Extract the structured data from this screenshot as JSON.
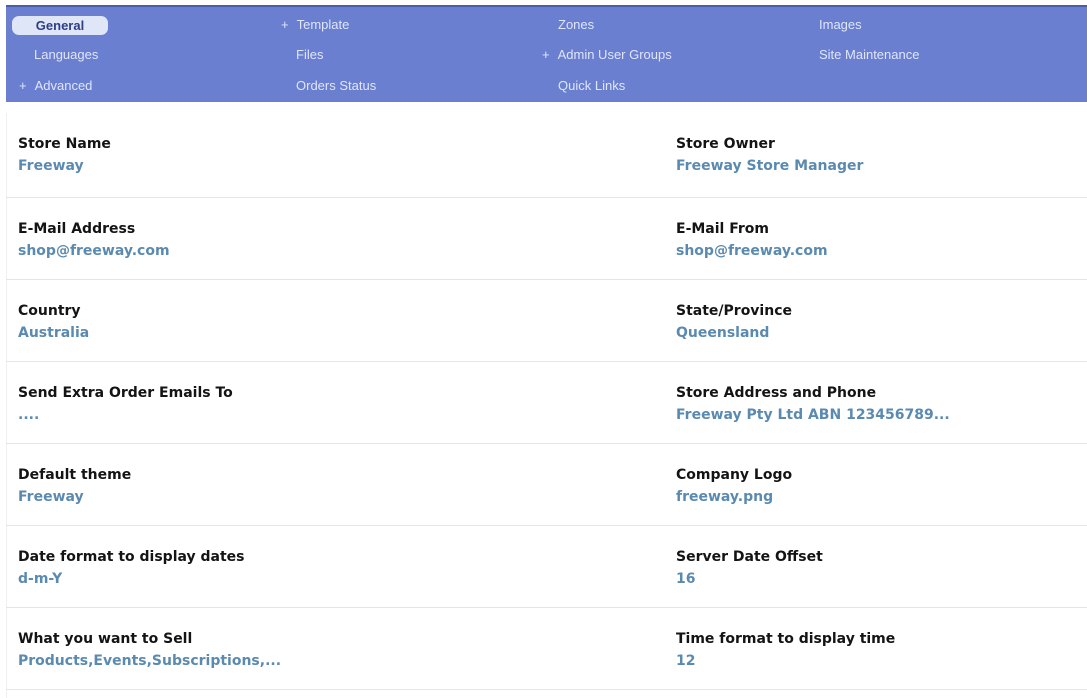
{
  "nav": {
    "col1": [
      {
        "label": "General",
        "plus": "",
        "active": true
      },
      {
        "label": "Languages",
        "plus": ""
      },
      {
        "label": "Advanced",
        "plus": "+"
      }
    ],
    "col2": [
      {
        "label": "Template",
        "plus": "+"
      },
      {
        "label": "Files",
        "plus": ""
      },
      {
        "label": "Orders Status",
        "plus": ""
      }
    ],
    "col3": [
      {
        "label": "Zones",
        "plus": ""
      },
      {
        "label": "Admin User Groups",
        "plus": "+"
      },
      {
        "label": "Quick Links",
        "plus": ""
      }
    ],
    "col4": [
      {
        "label": "Images",
        "plus": ""
      },
      {
        "label": "Site Maintenance",
        "plus": ""
      }
    ]
  },
  "settings": [
    {
      "left": {
        "label": "Store Name",
        "value": "Freeway"
      },
      "right": {
        "label": "Store Owner",
        "value": "Freeway Store Manager"
      }
    },
    {
      "left": {
        "label": "E-Mail Address",
        "value": "shop@freeway.com"
      },
      "right": {
        "label": "E-Mail From",
        "value": "shop@freeway.com"
      }
    },
    {
      "left": {
        "label": "Country",
        "value": "Australia"
      },
      "right": {
        "label": "State/Province",
        "value": "Queensland"
      }
    },
    {
      "left": {
        "label": "Send Extra Order Emails To",
        "value": "...."
      },
      "right": {
        "label": "Store Address and Phone",
        "value": "Freeway Pty Ltd ABN 123456789..."
      }
    },
    {
      "left": {
        "label": "Default theme",
        "value": "Freeway"
      },
      "right": {
        "label": "Company Logo",
        "value": "freeway.png"
      }
    },
    {
      "left": {
        "label": "Date format to display dates",
        "value": "d-m-Y"
      },
      "right": {
        "label": "Server Date Offset",
        "value": "16"
      }
    },
    {
      "left": {
        "label": "What you want to Sell",
        "value": "Products,Events,Subscriptions,..."
      },
      "right": {
        "label": "Time format to display time",
        "value": "12"
      }
    }
  ],
  "colors": {
    "nav_bg": "#6a7fd0",
    "value_text": "#5b8ab0",
    "active_tab_bg": "#dfe6f7"
  }
}
